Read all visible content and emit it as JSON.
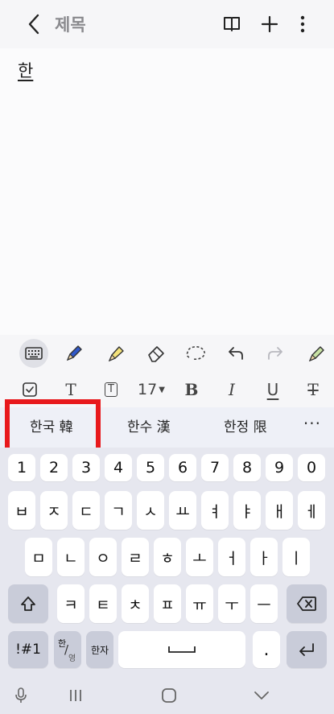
{
  "header": {
    "title": "제목",
    "back_icon": "chevron-left-icon",
    "book_icon": "book-icon",
    "add_icon": "plus-icon",
    "more_icon": "kebab-icon"
  },
  "editor": {
    "text": "한"
  },
  "tools": [
    "keyboard-icon",
    "pen-icon",
    "highlighter-icon",
    "eraser-icon",
    "lasso-icon",
    "undo-icon",
    "redo-icon",
    "marker-icon"
  ],
  "format": {
    "font_size": "17",
    "bold": "B",
    "italic": "I",
    "underline": "U",
    "strike": "T",
    "text_t": "T",
    "text_box_t": "T"
  },
  "suggestions": [
    "한국 韓",
    "한수 漢",
    "한정 限"
  ],
  "suggestions_more": "···",
  "keyboard": {
    "row1": [
      "1",
      "2",
      "3",
      "4",
      "5",
      "6",
      "7",
      "8",
      "9",
      "0"
    ],
    "row2": [
      "ㅂ",
      "ㅈ",
      "ㄷ",
      "ㄱ",
      "ㅅ",
      "ㅛ",
      "ㅕ",
      "ㅑ",
      "ㅐ",
      "ㅔ"
    ],
    "row3": [
      "ㅁ",
      "ㄴ",
      "ㅇ",
      "ㄹ",
      "ㅎ",
      "ㅗ",
      "ㅓ",
      "ㅏ",
      "ㅣ"
    ],
    "row4": [
      "ㅋ",
      "ㅌ",
      "ㅊ",
      "ㅍ",
      "ㅠ",
      "ㅜ",
      "ㅡ"
    ],
    "symbols": "!#1",
    "lang_top": "한",
    "lang_bottom": "영",
    "hanja": "한자",
    "period": "."
  },
  "colors": {
    "accent_red": "#e8191c",
    "key_bg": "#ffffff",
    "keyboard_bg": "#e6e7ef"
  }
}
